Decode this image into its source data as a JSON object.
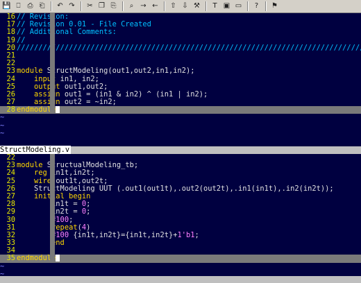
{
  "toolbar": {
    "buttons": [
      {
        "name": "save-icon",
        "glyph": "💾"
      },
      {
        "name": "save-all-icon",
        "glyph": "⎕"
      },
      {
        "name": "print-icon",
        "glyph": "⎙"
      },
      {
        "name": "print-preview-icon",
        "glyph": "⎗"
      },
      {
        "name": "undo-icon",
        "glyph": "↶"
      },
      {
        "name": "redo-icon",
        "glyph": "↷"
      },
      {
        "name": "cut-icon",
        "glyph": "✂"
      },
      {
        "name": "copy-icon",
        "glyph": "❐"
      },
      {
        "name": "paste-icon",
        "glyph": "⎘"
      },
      {
        "name": "find-icon",
        "glyph": "⌕"
      },
      {
        "name": "find-next-icon",
        "glyph": "→"
      },
      {
        "name": "find-prev-icon",
        "glyph": "←"
      },
      {
        "name": "load-session-icon",
        "glyph": "⇧"
      },
      {
        "name": "save-session-icon",
        "glyph": "⇩"
      },
      {
        "name": "run-script-icon",
        "glyph": "⚒"
      },
      {
        "name": "make-icon",
        "glyph": "T"
      },
      {
        "name": "tags-icon",
        "glyph": "▣"
      },
      {
        "name": "jump-tag-icon",
        "glyph": "▭"
      },
      {
        "name": "help-icon",
        "glyph": "?"
      },
      {
        "name": "search-help-icon",
        "glyph": "⚑"
      }
    ]
  },
  "top_pane": {
    "lines": [
      {
        "n": "16",
        "segs": [
          {
            "c": "cm",
            "t": "// Revision:"
          }
        ]
      },
      {
        "n": "17",
        "segs": [
          {
            "c": "cm",
            "t": "// Revision 0.01 - File Created"
          }
        ]
      },
      {
        "n": "18",
        "segs": [
          {
            "c": "cm",
            "t": "// Additional Comments:"
          }
        ]
      },
      {
        "n": "19",
        "segs": [
          {
            "c": "cm",
            "t": "//"
          }
        ]
      },
      {
        "n": "20",
        "segs": [
          {
            "c": "cm",
            "t": "////////////////////////////////////////////////////////////////////////////////"
          }
        ]
      },
      {
        "n": "21",
        "segs": []
      },
      {
        "n": "22",
        "segs": []
      },
      {
        "n": "23",
        "segs": [
          {
            "c": "kw",
            "t": "module "
          },
          {
            "c": "pl",
            "t": "StructModeling(out1,out2,in1,in2);"
          }
        ]
      },
      {
        "n": "24",
        "segs": [
          {
            "c": "pl",
            "t": "    "
          },
          {
            "c": "kw",
            "t": "input "
          },
          {
            "c": "pl",
            "t": "in1, in2;"
          }
        ]
      },
      {
        "n": "25",
        "segs": [
          {
            "c": "pl",
            "t": "    "
          },
          {
            "c": "kw",
            "t": "output "
          },
          {
            "c": "pl",
            "t": "out1,out2;"
          }
        ]
      },
      {
        "n": "26",
        "segs": [
          {
            "c": "pl",
            "t": "    "
          },
          {
            "c": "kw",
            "t": "assign "
          },
          {
            "c": "pl",
            "t": "out1 = (in1 & in2) ^ (in1 | in2);"
          }
        ]
      },
      {
        "n": "27",
        "segs": [
          {
            "c": "pl",
            "t": "    "
          },
          {
            "c": "kw",
            "t": "assign "
          },
          {
            "c": "pl",
            "t": "out2 = ~in2;"
          }
        ]
      },
      {
        "n": "28",
        "cursor": true,
        "segs": [
          {
            "c": "kw",
            "t": "endmodule"
          }
        ]
      }
    ],
    "tildes": [
      "~",
      "~",
      "~"
    ],
    "filename": "StructModeling.v"
  },
  "bottom_pane": {
    "lines": [
      {
        "n": "22",
        "segs": []
      },
      {
        "n": "23",
        "segs": [
          {
            "c": "kw",
            "t": "module "
          },
          {
            "c": "pl",
            "t": "StructualModeling_tb;"
          }
        ]
      },
      {
        "n": "24",
        "segs": [
          {
            "c": "pl",
            "t": "    "
          },
          {
            "c": "kw",
            "t": "reg "
          },
          {
            "c": "pl",
            "t": "in1t,in2t;"
          }
        ]
      },
      {
        "n": "25",
        "segs": [
          {
            "c": "pl",
            "t": "    "
          },
          {
            "c": "kw",
            "t": "wire "
          },
          {
            "c": "pl",
            "t": "out1t,out2t;"
          }
        ]
      },
      {
        "n": "26",
        "segs": [
          {
            "c": "pl",
            "t": "    StructModeling UUT (.out1(out1t),.out2(out2t),.in1(in1t),.in2(in2t));"
          }
        ]
      },
      {
        "n": "27",
        "segs": [
          {
            "c": "pl",
            "t": "    "
          },
          {
            "c": "kw",
            "t": "initial begin"
          }
        ]
      },
      {
        "n": "28",
        "segs": [
          {
            "c": "pl",
            "t": "        in1t = "
          },
          {
            "c": "num",
            "t": "0"
          },
          {
            "c": "pl",
            "t": ";"
          }
        ]
      },
      {
        "n": "29",
        "segs": [
          {
            "c": "pl",
            "t": "        in2t = "
          },
          {
            "c": "num",
            "t": "0"
          },
          {
            "c": "pl",
            "t": ";"
          }
        ]
      },
      {
        "n": "30",
        "segs": [
          {
            "c": "pl",
            "t": "        "
          },
          {
            "c": "num",
            "t": "#100"
          },
          {
            "c": "pl",
            "t": ";"
          }
        ]
      },
      {
        "n": "31",
        "segs": [
          {
            "c": "pl",
            "t": "        "
          },
          {
            "c": "kw",
            "t": "repeat"
          },
          {
            "c": "pl",
            "t": "("
          },
          {
            "c": "num",
            "t": "4"
          },
          {
            "c": "pl",
            "t": ")"
          }
        ]
      },
      {
        "n": "32",
        "segs": [
          {
            "c": "pl",
            "t": "        "
          },
          {
            "c": "num",
            "t": "#100 "
          },
          {
            "c": "pl",
            "t": "{in1t,in2t}={in1t,in2t}+"
          },
          {
            "c": "num",
            "t": "1'b1"
          },
          {
            "c": "pl",
            "t": ";"
          }
        ]
      },
      {
        "n": "33",
        "segs": [
          {
            "c": "pl",
            "t": "        "
          },
          {
            "c": "kw",
            "t": "end"
          }
        ]
      },
      {
        "n": "34",
        "segs": []
      },
      {
        "n": "35",
        "cursor": true,
        "segs": [
          {
            "c": "kw",
            "t": "endmodule"
          }
        ]
      }
    ],
    "tildes": [
      "~",
      "~"
    ]
  },
  "colors": {
    "background": "#000040",
    "comment": "#00c0ff",
    "keyword": "#ffd700",
    "number": "#ff80ff",
    "line_number": "#e8e800",
    "cursorline": "#7a7a7a",
    "tilde": "#8080ff"
  }
}
